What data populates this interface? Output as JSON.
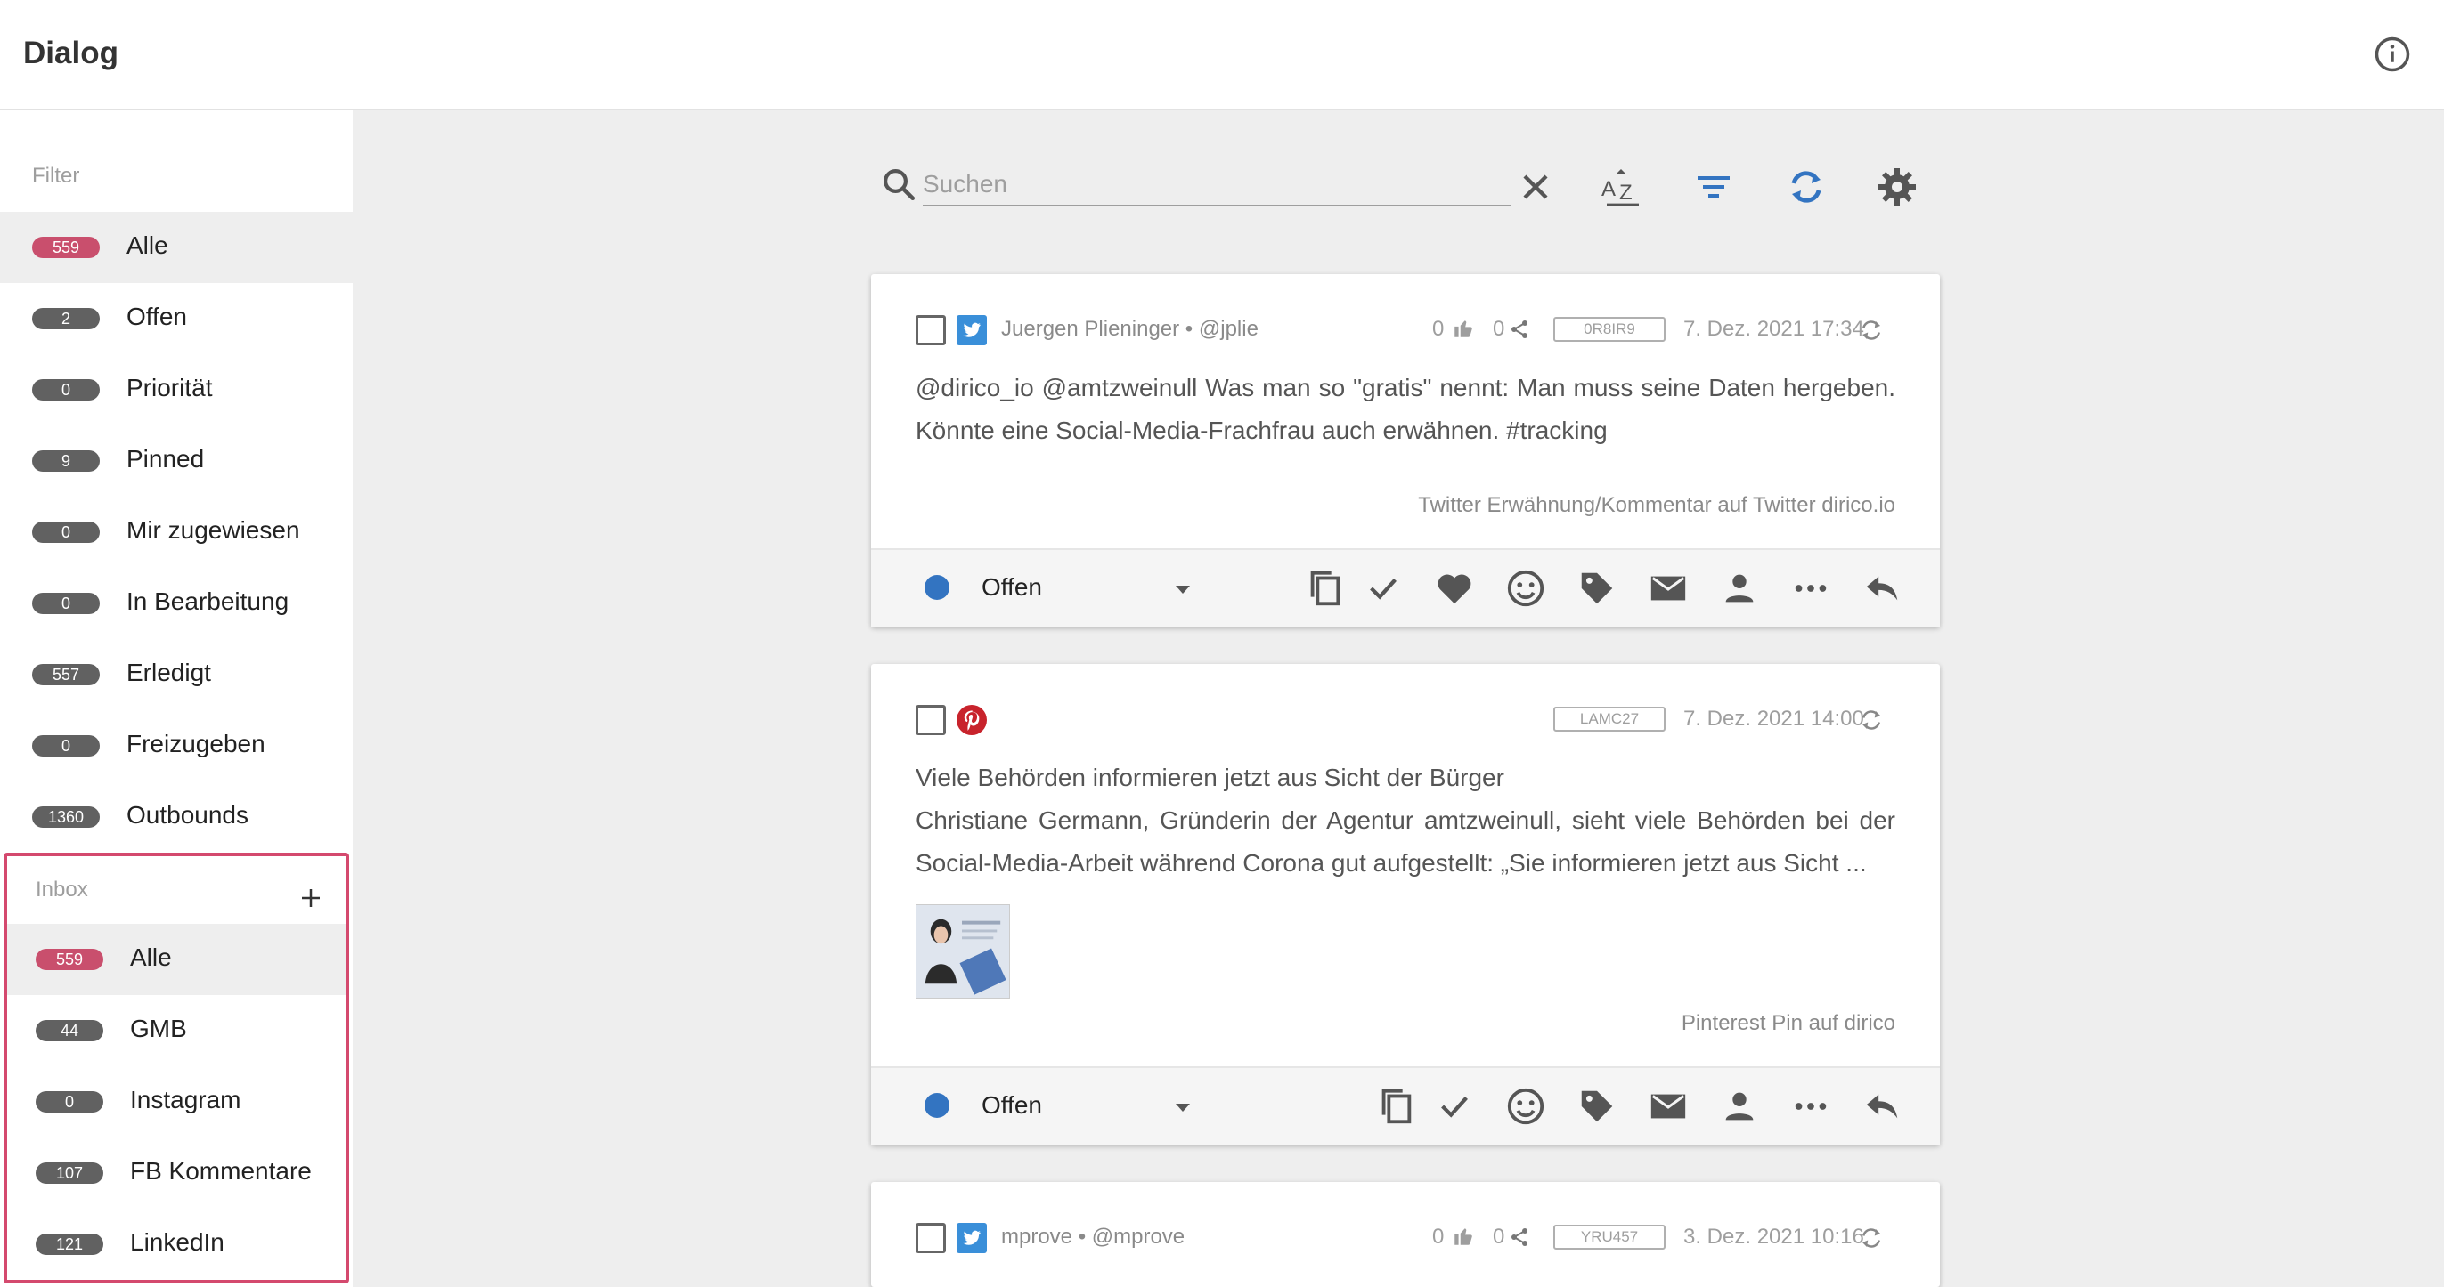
{
  "app": {
    "title": "Dialog"
  },
  "sidebar": {
    "filter_label": "Filter",
    "filters": [
      {
        "count": "559",
        "label": "Alle",
        "highlight": true,
        "active": true
      },
      {
        "count": "2",
        "label": "Offen"
      },
      {
        "count": "0",
        "label": "Priorität"
      },
      {
        "count": "9",
        "label": "Pinned"
      },
      {
        "count": "0",
        "label": "Mir zugewiesen"
      },
      {
        "count": "0",
        "label": "In Bearbeitung"
      },
      {
        "count": "557",
        "label": "Erledigt"
      },
      {
        "count": "0",
        "label": "Freizugeben"
      },
      {
        "count": "1360",
        "label": "Outbounds"
      }
    ],
    "inbox_label": "Inbox",
    "inboxes": [
      {
        "count": "559",
        "label": "Alle",
        "highlight": true,
        "active": true
      },
      {
        "count": "44",
        "label": "GMB"
      },
      {
        "count": "0",
        "label": "Instagram"
      },
      {
        "count": "107",
        "label": "FB Kommentare"
      },
      {
        "count": "121",
        "label": "LinkedIn"
      }
    ]
  },
  "search": {
    "placeholder": "Suchen",
    "value": ""
  },
  "colors": {
    "accent": "#3374c1",
    "badge_highlight": "#c94f6d",
    "badge": "#616161",
    "inbox_border": "#d4496e"
  },
  "cards": [
    {
      "network": "twitter-icon",
      "author": "Juergen Plieninger • @jplie",
      "likes": "0",
      "shares": "0",
      "code": "0R8IR9",
      "date": "7. Dez. 2021 17:34",
      "text": "@dirico_io @amtzweinull Was man so \"gratis\" nennt: Man muss seine Daten hergeben. Könnte eine Social-Media-Frachfrau auch erwähnen. #tracking",
      "source_type": "Twitter Erwähnung/Kommentar",
      "source_on": "auf",
      "source_account": "Twitter dirico.io",
      "status": "Offen"
    },
    {
      "network": "pinterest-icon",
      "author": "",
      "code": "LAMC27",
      "date": "7. Dez. 2021 14:00",
      "headline": "Viele Behörden informieren jetzt aus Sicht der Bürger",
      "text": "Christiane Germann, Gründerin der Agentur amtzweinull, sieht viele Behörden bei der Social-Media-Arbeit während Corona gut aufgestellt: „Sie informieren jetzt aus Sicht ...",
      "source_type": "Pinterest Pin",
      "source_on": "auf",
      "source_account": "dirico",
      "status": "Offen"
    },
    {
      "network": "twitter-icon",
      "author": "mprove • @mprove",
      "likes": "0",
      "shares": "0",
      "code": "YRU457",
      "date": "3. Dez. 2021 10:16"
    }
  ]
}
